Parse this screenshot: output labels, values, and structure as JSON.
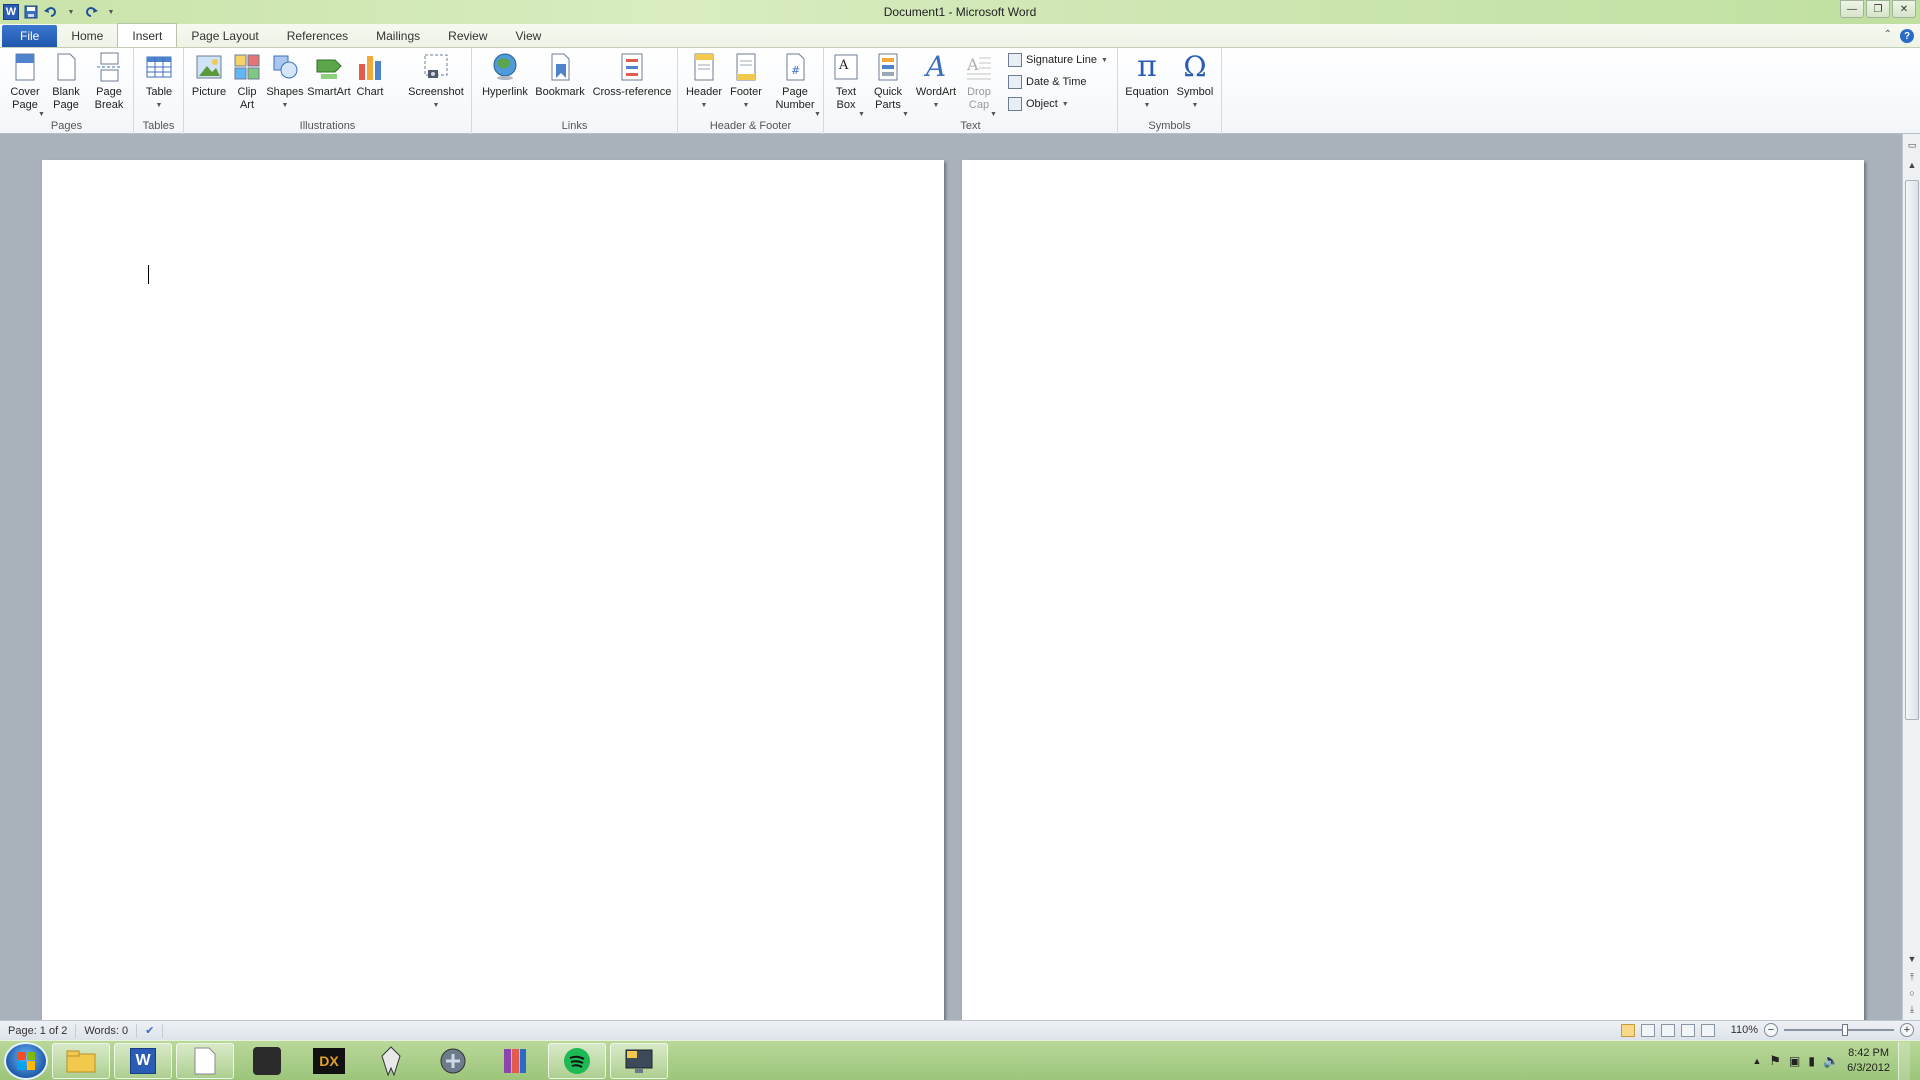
{
  "window": {
    "title": "Document1  -  Microsoft Word",
    "app_logo": "W"
  },
  "qat": {
    "icons": [
      "save-icon",
      "undo-icon",
      "redo-icon",
      "customize-icon"
    ]
  },
  "tabs": [
    "File",
    "Home",
    "Insert",
    "Page Layout",
    "References",
    "Mailings",
    "Review",
    "View"
  ],
  "active_tab": "Insert",
  "ribbon": {
    "groups": {
      "pages": {
        "label": "Pages",
        "cover": "Cover\nPage",
        "blank": "Blank\nPage",
        "break": "Page\nBreak"
      },
      "tables": {
        "label": "Tables",
        "table": "Table"
      },
      "illustrations": {
        "label": "Illustrations",
        "picture": "Picture",
        "clipart": "Clip\nArt",
        "shapes": "Shapes",
        "smartart": "SmartArt",
        "chart": "Chart",
        "screenshot": "Screenshot"
      },
      "links": {
        "label": "Links",
        "hyperlink": "Hyperlink",
        "bookmark": "Bookmark",
        "crossref": "Cross-reference"
      },
      "headerfooter": {
        "label": "Header & Footer",
        "header": "Header",
        "footer": "Footer",
        "pagenumber": "Page\nNumber"
      },
      "text": {
        "label": "Text",
        "textbox": "Text\nBox",
        "quickparts": "Quick\nParts",
        "wordart": "WordArt",
        "dropcap": "Drop\nCap",
        "signature": "Signature Line",
        "datetime": "Date & Time",
        "object": "Object"
      },
      "symbols": {
        "label": "Symbols",
        "equation": "Equation",
        "symbol": "Symbol"
      }
    },
    "glyphs": {
      "pi": "π",
      "omega": "Ω",
      "wordart": "A"
    }
  },
  "status": {
    "page": "Page: 1 of 2",
    "words": "Words: 0",
    "zoom": "110%",
    "zoom_fraction": 0.55
  },
  "taskbar": {
    "clock_time": "8:42 PM",
    "clock_date": "6/3/2012",
    "apps": [
      "explorer-icon",
      "word-icon",
      "document-icon",
      "game-skull-icon",
      "dx-icon",
      "skyrim-icon",
      "starcraft-icon",
      "winrar-icon",
      "spotify-icon",
      "monitor-icon"
    ],
    "dx_label": "DX"
  },
  "colors": {
    "accent": "#2a5bb5",
    "ribbon_bg": "#ffffff",
    "doc_bg": "#a9b1bb",
    "taskbar": "#a9cf86"
  }
}
